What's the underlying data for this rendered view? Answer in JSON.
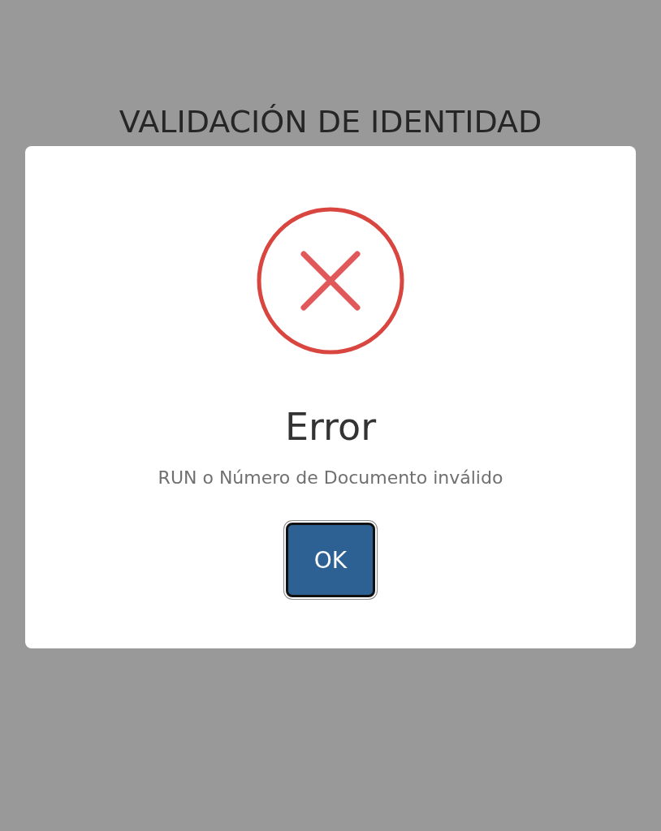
{
  "page_title": "VALIDACIÓN DE IDENTIDAD",
  "dialog": {
    "kind": "error",
    "title": "Error",
    "message": "RUN o Número de Documento inválido",
    "buttons": [
      "OK"
    ]
  }
}
